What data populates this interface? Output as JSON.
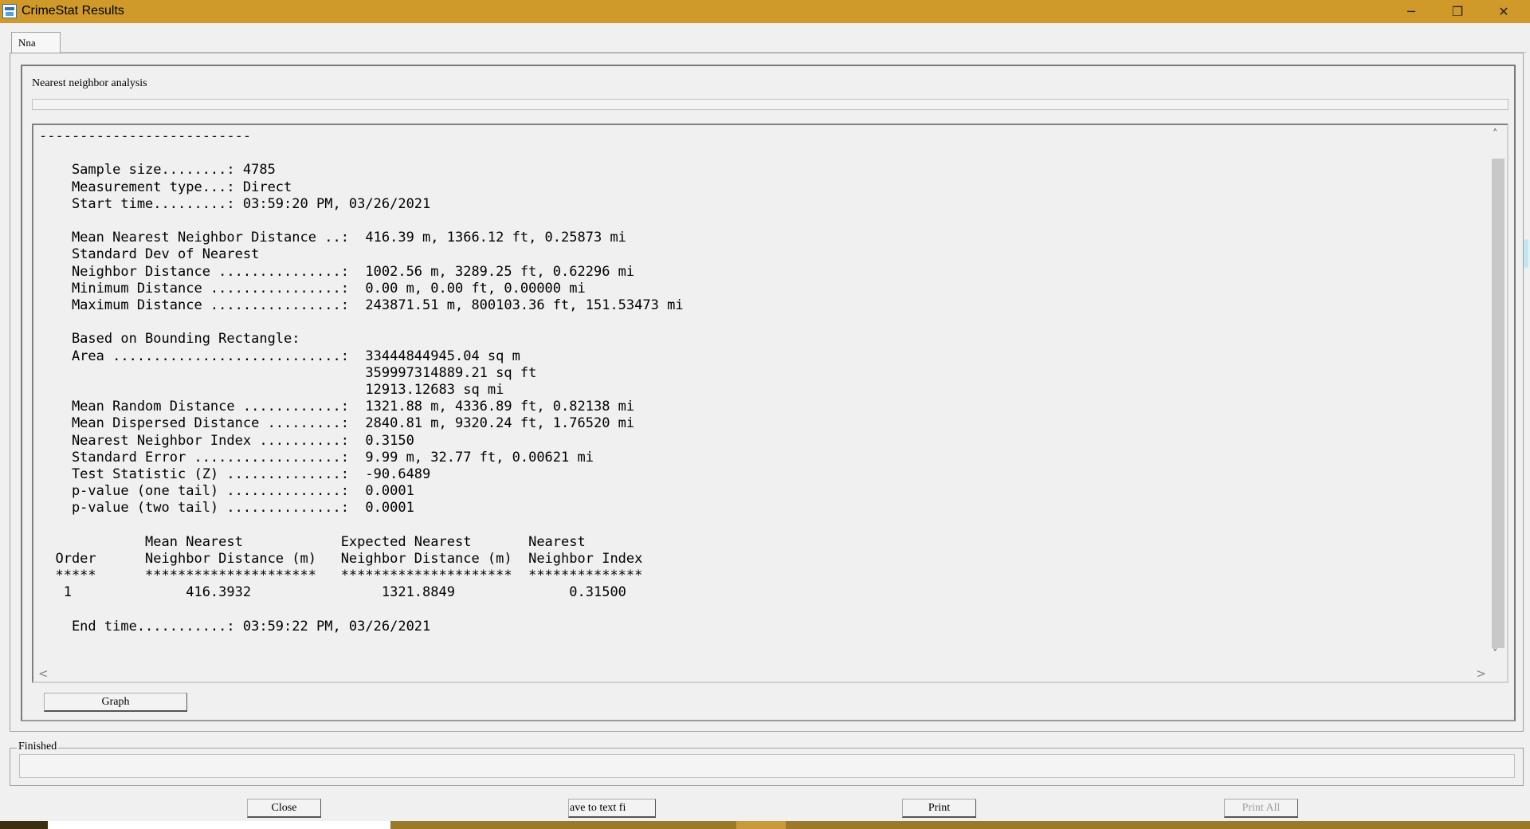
{
  "window": {
    "title": "CrimeStat Results",
    "controls": {
      "minimize": "─",
      "maximize": "❐",
      "close": "✕"
    }
  },
  "tabs": [
    {
      "label": "Nna",
      "active": true
    }
  ],
  "section": {
    "label": "Nearest neighbor analysis"
  },
  "output": {
    "lines": [
      "--------------------------",
      "",
      "    Sample size........: 4785",
      "    Measurement type...: Direct",
      "    Start time.........: 03:59:20 PM, 03/26/2021",
      "",
      "    Mean Nearest Neighbor Distance ..:  416.39 m, 1366.12 ft, 0.25873 mi",
      "    Standard Dev of Nearest",
      "    Neighbor Distance ...............:  1002.56 m, 3289.25 ft, 0.62296 mi",
      "    Minimum Distance ................:  0.00 m, 0.00 ft, 0.00000 mi",
      "    Maximum Distance ................:  243871.51 m, 800103.36 ft, 151.53473 mi",
      "",
      "    Based on Bounding Rectangle:",
      "    Area ............................:  33444844945.04 sq m",
      "                                        359997314889.21 sq ft",
      "                                        12913.12683 sq mi",
      "    Mean Random Distance ............:  1321.88 m, 4336.89 ft, 0.82138 mi",
      "    Mean Dispersed Distance .........:  2840.81 m, 9320.24 ft, 1.76520 mi",
      "    Nearest Neighbor Index ..........:  0.3150",
      "    Standard Error ..................:  9.99 m, 32.77 ft, 0.00621 mi",
      "    Test Statistic (Z) ..............:  -90.6489",
      "    p-value (one tail) ..............:  0.0001",
      "    p-value (two tail) ..............:  0.0001",
      "",
      "             Mean Nearest            Expected Nearest       Nearest",
      "  Order      Neighbor Distance (m)   Neighbor Distance (m)  Neighbor Index",
      "  *****      *********************   *********************  **************",
      "   1              416.3932                1321.8849              0.31500",
      "",
      "    End time...........: 03:59:22 PM, 03/26/2021"
    ]
  },
  "buttons": {
    "graph": "Graph",
    "close": "Close",
    "save": "ave to text fi",
    "print": "Print",
    "print_all": "Print All"
  },
  "status": {
    "label": "Finished",
    "value": ""
  },
  "icons": {
    "scroll_up": "˄",
    "scroll_down": "˅",
    "scroll_left": "<",
    "scroll_right": ">"
  },
  "colors": {
    "titlebar": "#cf9a2a",
    "background": "#f0f0f0"
  }
}
